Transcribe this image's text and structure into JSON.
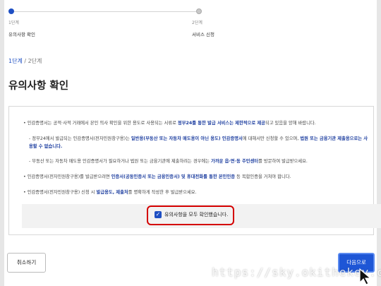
{
  "stepper": {
    "steps": [
      {
        "num": "1단계",
        "title": "유의사항 확인"
      },
      {
        "num": "2단계",
        "title": "서비스 신청"
      }
    ]
  },
  "breadcrumb": {
    "current": "1단계",
    "separator": " / ",
    "next": "2단계"
  },
  "page_title": "유의사항 확인",
  "notice": {
    "p1": {
      "pre": "• 인감증명서는 공적·사적 거래에서 본인 의사 확인을 위한 용도로 사용되는 서류로 ",
      "bold": "정부24를 통한 발급 서비스는 제한적으로 제공",
      "post": "되고 있음을 양해 바랍니다."
    },
    "p2": {
      "pre": "- 정부24에서 발급되는 인감증명서(전자민원창구용)는 ",
      "bold1": "일반용(부동산 또는 자동차 매도용이 아닌 용도) 인감증명서",
      "mid": "에 대해서만 신청할 수 있으며, ",
      "bold2": "법원 또는 금융기관 제출용으로는 사용할 수 없습니다."
    },
    "p3": {
      "pre": "- 부동산 또는 자동차 매도용 인감증명서가 필요하거나 법원 또는 금융기관에 제출하려는 경우에는 ",
      "bold": "가까운 읍·면·동 주민센터",
      "post": "를 방문하여 발급받으세요."
    },
    "p4": {
      "pre": "• 인감증명서(전자민원창구용)를 발급받으려면 ",
      "bold": "인증서(공동인증서 또는 금융인증서) 및 휴대전화를 통한 본인인증",
      "post": " 등 복합인증을 거쳐야 합니다."
    },
    "p5": {
      "pre": "• 인감증명서(전자민원창구용) 신청 시 ",
      "bold": "발급용도, 제출처",
      "post": "를 명확하게 작성한 후 발급받으세요."
    }
  },
  "confirm": {
    "label": "유의사항을 모두 확인했습니다.",
    "checked": true
  },
  "buttons": {
    "cancel": "취소하기",
    "next": "다음으로"
  },
  "watermark": "https://sky.okithekey.com",
  "colors": {
    "accent": "#1e4fc3",
    "highlight": "#d40000",
    "next_button": "#1e56d6"
  },
  "icons": {
    "checkbox": "checkmark-icon",
    "cursor": "mouse-pointer-icon"
  }
}
